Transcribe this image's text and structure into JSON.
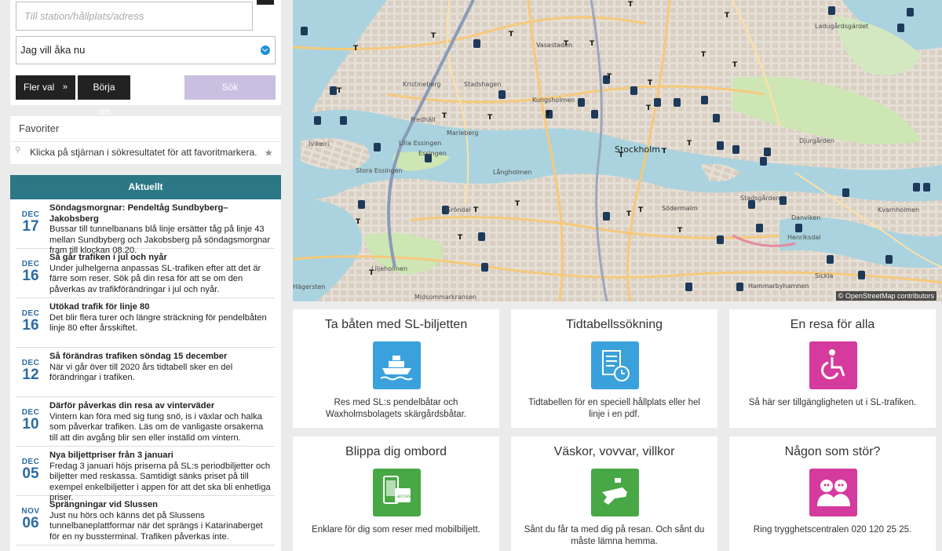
{
  "search": {
    "to_placeholder": "Till station/hållplats/adress",
    "when_value": "Jag vill åka nu",
    "more_options_label": "Fler val",
    "more_options_icon": "double-chevron-down",
    "restart_label": "Börja om",
    "search_label": "Sök"
  },
  "favorites": {
    "title": "Favoriter",
    "hint": "Klicka på stjärnan i sökresultatet för att favoritmarkera.",
    "pin_icon": "pin-icon",
    "star_icon": "star-icon"
  },
  "news": {
    "header": "Aktuellt",
    "items": [
      {
        "month": "DEC",
        "day": "17",
        "title": "Söndagsmorgnar: Pendeltåg Sundbyberg–Jakobsberg",
        "text": "Bussar till tunnelbanans blå linje ersätter tåg på linje 43 mellan Sundbyberg och Jakobsberg på söndagsmorgnar fram till klockan 08.20."
      },
      {
        "month": "DEC",
        "day": "16",
        "title": "Så går trafiken i jul och nyår",
        "text": "Under julhelgerna anpassas SL-trafiken efter att det är färre som reser. Sök på din resa för att se om den påverkas av trafikförändringar i jul och nyår."
      },
      {
        "month": "DEC",
        "day": "16",
        "title": "Utökad trafik för linje 80",
        "text": "Det blir flera turer och längre sträckning för pendelbåten linje 80 efter årsskiftet."
      },
      {
        "month": "DEC",
        "day": "12",
        "title": "Så förändras trafiken söndag 15 december",
        "text": "När vi går över till 2020 års tidtabell sker en del förändringar i trafiken."
      },
      {
        "month": "DEC",
        "day": "10",
        "title": "Därför påverkas din resa av vinterväder",
        "text": "Vintern kan föra med sig tung snö, is i växlar och halka som påverkar trafiken. Läs om de vanligaste orsakerna till att din avgång blir sen eller inställd om vintern."
      },
      {
        "month": "DEC",
        "day": "05",
        "title": "Nya biljettpriser från 3 januari",
        "text": "Fredag 3 januari höjs priserna på SL:s periodbiljetter och biljetter med reskassa. Samtidigt sänks priset på till exempel enkelbiljetter i appen för att det ska bli enhetliga priser."
      },
      {
        "month": "NOV",
        "day": "06",
        "title": "Sprängningar vid Slussen",
        "text": "Just nu hörs och känns det på Slussens tunnelbaneplattformar när det sprängs i Katarinaberget för en ny bussterminal. Trafiken påverkas inte."
      }
    ]
  },
  "map": {
    "attribution": "© OpenStreetMap contributors",
    "places": [
      "Vasastaden",
      "Kristineberg",
      "Stadshagen",
      "Kungsholmen",
      "Fredhäll",
      "Marieberg",
      "Lilla Essingen",
      "Stora Essingen",
      "Långholmen",
      "Stockholm",
      "Gröndal",
      "Södermalm",
      "Danviken",
      "Henriksdal",
      "Kvarnholmen",
      "Djurgården",
      "Ladugårdsgärdet",
      "Midsommarkransen",
      "Hägersten",
      "Liljeholmen",
      "Sickla",
      "Hammarbyhamnen",
      "Essingen",
      "Stadsgården",
      "Ivikeiri"
    ]
  },
  "cards": [
    {
      "title": "Ta båten med SL-biljetten",
      "text": "Res med SL:s pendelbåtar och Waxholmsbolagets skärgårdsbåtar.",
      "icon": "ferry-icon",
      "color": "#3aa1dc"
    },
    {
      "title": "Tidtabellssökning",
      "text": "Tidtabellen för en speciell hållplats eller hel linje i en pdf.",
      "icon": "timetable-clock-icon",
      "color": "#3aa1dc"
    },
    {
      "title": "En resa för alla",
      "text": "Så här ser tillgängligheten ut i SL-trafiken.",
      "icon": "wheelchair-icon",
      "color": "#d53a9d"
    },
    {
      "title": "Blippa dig ombord",
      "text": "Enklare för dig som reser med mobilbiljett.",
      "icon": "mobile-ticket-icon",
      "color": "#48a845"
    },
    {
      "title": "Väskor, vovvar, villkor",
      "text": "Sånt du får ta med dig på resan. Och sånt du måste lämna hemma.",
      "icon": "luggage-dog-icon",
      "color": "#48a845"
    },
    {
      "title": "Någon som stör?",
      "text": "Ring trygghetscentralen 020 120 25 25.",
      "icon": "people-icon",
      "color": "#d53a9d"
    }
  ],
  "colors": {
    "accent": "#2c7785",
    "date": "#2c6aa3",
    "search_disabled": "#c9bfe0"
  }
}
